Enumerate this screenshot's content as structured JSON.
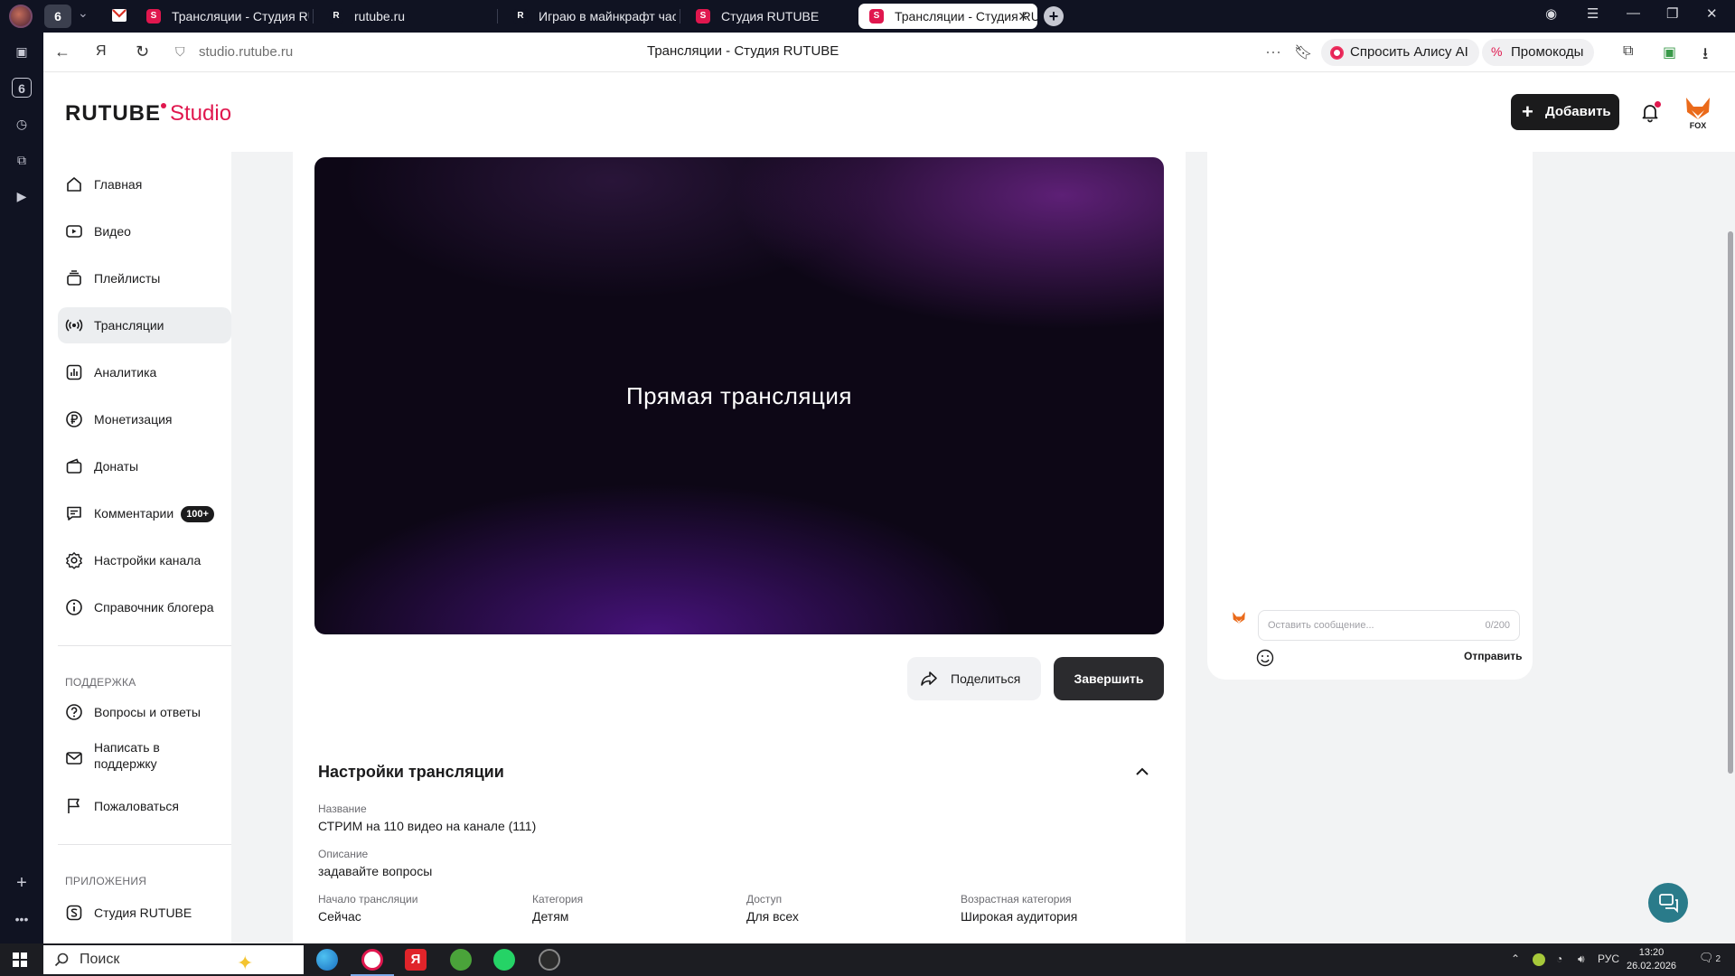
{
  "browser": {
    "profile_count": "6",
    "tabs": [
      {
        "title": "Трансляции - Студия RUTUBE",
        "icon": "rutube-studio-favicon"
      },
      {
        "title": "rutube.ru",
        "icon": "rutube-favicon"
      },
      {
        "title": "Играю в майнкрафт частично",
        "icon": "rutube-favicon"
      },
      {
        "title": "Студия RUTUBE",
        "icon": "rutube-studio-favicon"
      },
      {
        "title": "Трансляции - Студия RUTUBE",
        "icon": "rutube-studio-favicon"
      }
    ],
    "url": "studio.rutube.ru",
    "page_title": "Трансляции - Студия RUTUBE",
    "alice_label": "Спросить Алису AI",
    "promo_label": "Промокоды",
    "left_rail_badge": "6"
  },
  "header": {
    "logo_main": "RUTUBE",
    "logo_studio": "Studio",
    "add_label": "Добавить"
  },
  "sidebar": {
    "items": [
      {
        "label": "Главная",
        "icon": "home-icon"
      },
      {
        "label": "Видео",
        "icon": "video-icon"
      },
      {
        "label": "Плейлисты",
        "icon": "playlists-icon"
      },
      {
        "label": "Трансляции",
        "icon": "broadcast-icon",
        "active": true
      },
      {
        "label": "Аналитика",
        "icon": "analytics-icon"
      },
      {
        "label": "Монетизация",
        "icon": "ruble-icon"
      },
      {
        "label": "Донаты",
        "icon": "wallet-icon"
      },
      {
        "label": "Комментарии",
        "icon": "comment-icon",
        "badge": "100+"
      },
      {
        "label": "Настройки канала",
        "icon": "gear-icon"
      },
      {
        "label": "Справочник блогера",
        "icon": "info-icon"
      }
    ],
    "support_heading": "ПОДДЕРЖКА",
    "support_items": [
      {
        "label": "Вопросы и ответы",
        "icon": "question-icon"
      },
      {
        "label": "Написать в поддержку",
        "icon": "mail-icon"
      },
      {
        "label": "Пожаловаться",
        "icon": "flag-icon"
      }
    ],
    "apps_heading": "ПРИЛОЖЕНИЯ",
    "apps_items": [
      {
        "label": "Студия RUTUBE",
        "icon": "studio-app-icon"
      }
    ]
  },
  "player": {
    "overlay_text": "Прямая трансляция"
  },
  "actions": {
    "share_label": "Поделиться",
    "finish_label": "Завершить"
  },
  "settings": {
    "title": "Настройки трансляции",
    "name_label": "Название",
    "name_value": "СТРИМ на 110 видео на канале (111)",
    "description_label": "Описание",
    "description_value": "задавайте вопросы",
    "start_label": "Начало трансляции",
    "start_value": "Сейчас",
    "category_label": "Категория",
    "category_value": "Детям",
    "access_label": "Доступ",
    "access_value": "Для всех",
    "age_label": "Возрастная категория",
    "age_value": "Широкая аудитория"
  },
  "chat": {
    "placeholder": "Оставить сообщение...",
    "counter": "0/200",
    "send_label": "Отправить"
  },
  "taskbar": {
    "search_label": "Поиск",
    "lang": "РУС",
    "time": "13:20",
    "date": "26.02.2026",
    "notifications": "2"
  },
  "colors": {
    "brand_accent": "#e0174e",
    "dark_button": "#1b1b1c",
    "active_item_bg": "#eceef0"
  }
}
